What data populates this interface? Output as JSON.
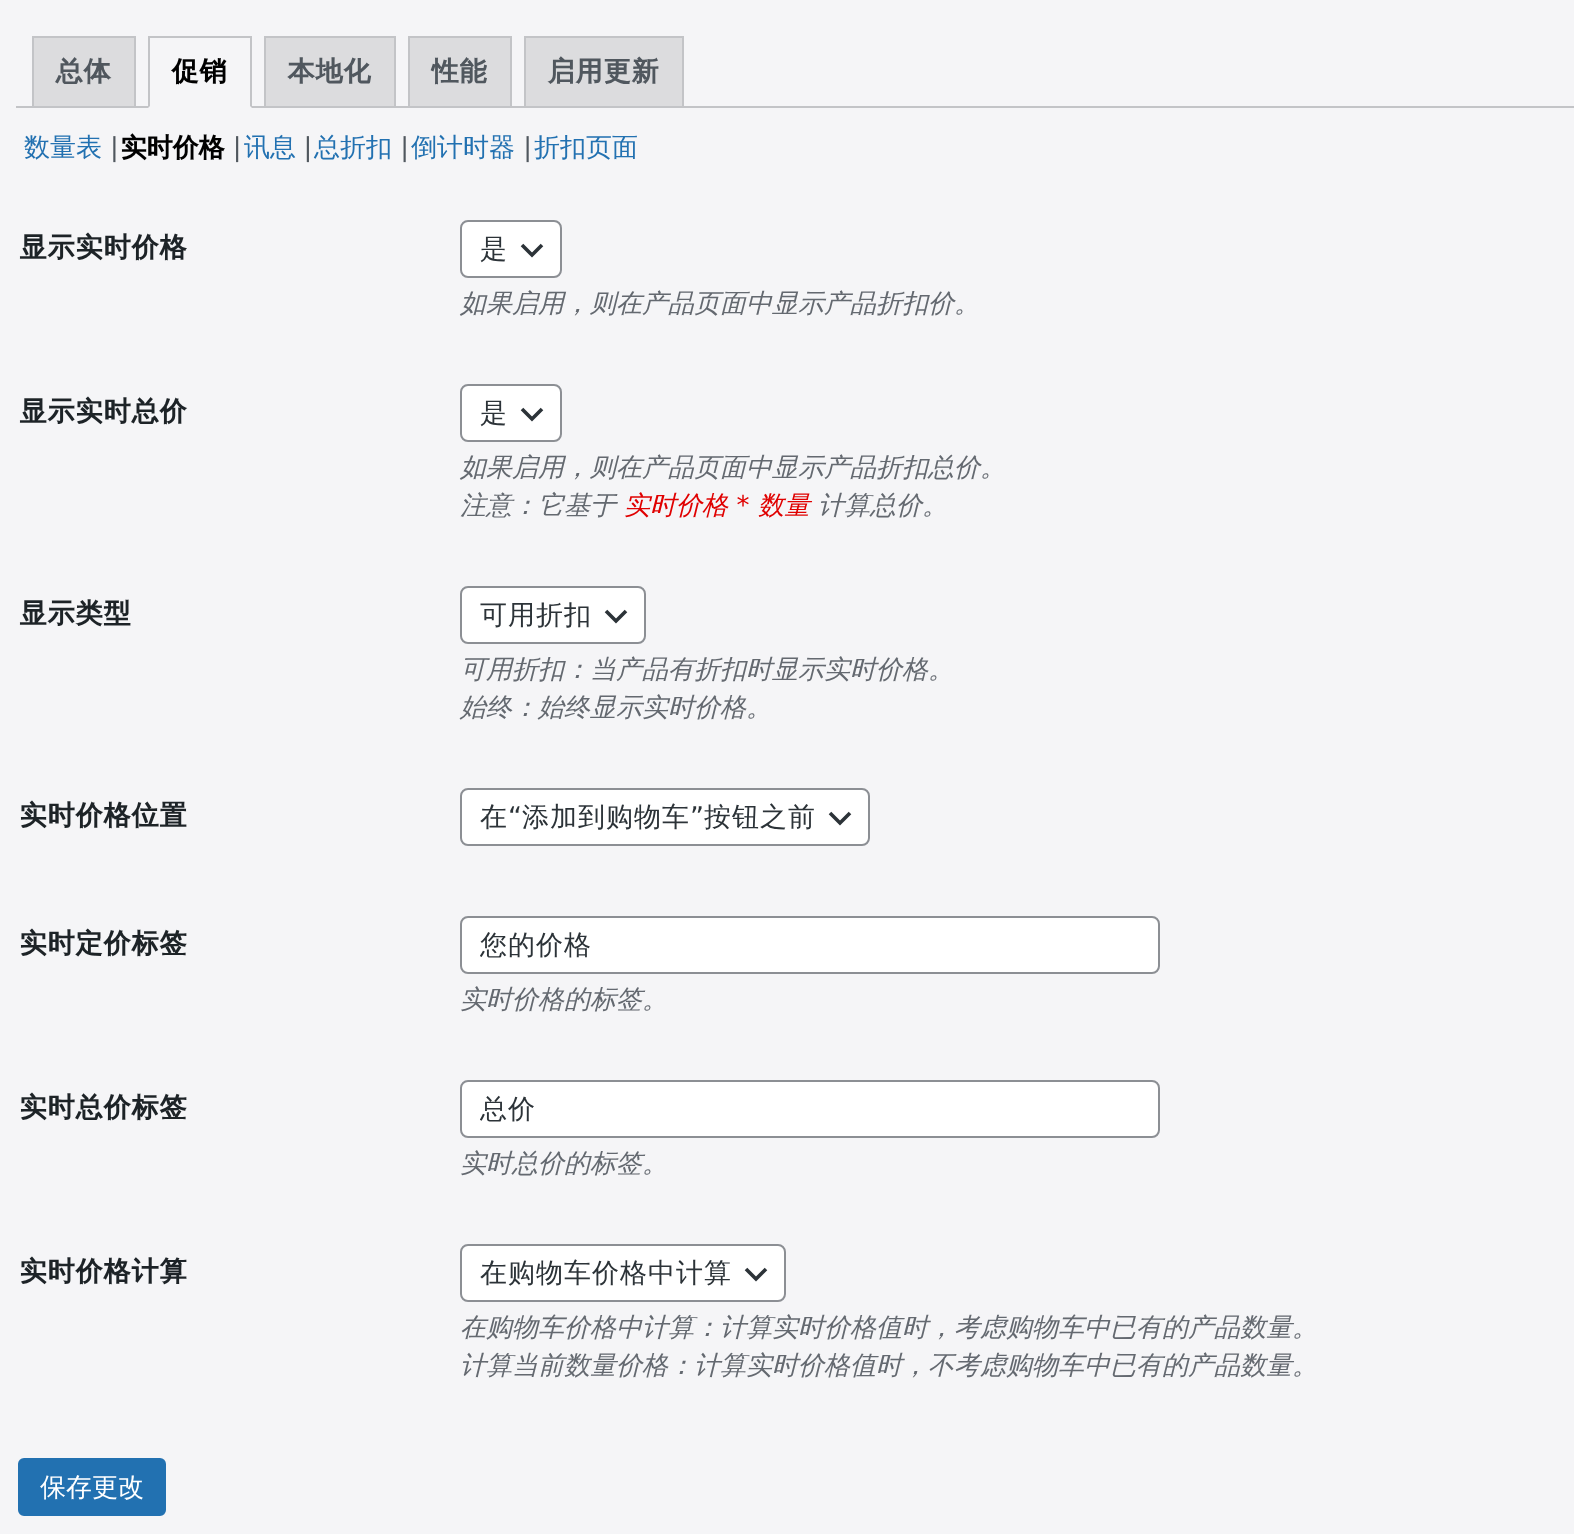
{
  "tabs": [
    {
      "label": "总体",
      "selected": false
    },
    {
      "label": "促销",
      "selected": true
    },
    {
      "label": "本地化",
      "selected": false
    },
    {
      "label": "性能",
      "selected": false
    },
    {
      "label": "启用更新",
      "selected": false
    }
  ],
  "subnav": [
    {
      "label": "数量表",
      "selected": false
    },
    {
      "separator": "|",
      "label": "实时价格",
      "selected": true
    },
    {
      "separator": "|",
      "label": "讯息",
      "selected": false
    },
    {
      "separator": "|",
      "label": "总折扣",
      "selected": false
    },
    {
      "separator": "|",
      "label": "倒计时器",
      "selected": false
    },
    {
      "separator": "|",
      "label": "折扣页面",
      "selected": false
    }
  ],
  "settings": [
    {
      "label": "显示实时价格",
      "control": {
        "kind": "select",
        "value": "是"
      },
      "description": [
        [
          {
            "text": "如果启用，则在产品页面中显示产品折扣价。",
            "highlight": false
          }
        ]
      ]
    },
    {
      "label": "显示实时总价",
      "control": {
        "kind": "select",
        "value": "是"
      },
      "description": [
        [
          {
            "text": "如果启用，则在产品页面中显示产品折扣总价。",
            "highlight": false
          }
        ],
        [
          {
            "text": "注意：它基于 ",
            "highlight": false
          },
          {
            "text": "实时价格 * 数量",
            "highlight": true
          },
          {
            "text": " 计算总价。",
            "highlight": false
          }
        ]
      ]
    },
    {
      "label": "显示类型",
      "control": {
        "kind": "select",
        "value": "可用折扣"
      },
      "description": [
        [
          {
            "text": "可用折扣：当产品有折扣时显示实时价格。",
            "highlight": false
          }
        ],
        [
          {
            "text": "始终：始终显示实时价格。",
            "highlight": false
          }
        ]
      ]
    },
    {
      "label": "实时价格位置",
      "control": {
        "kind": "select",
        "value": "在“添加到购物车”按钮之前"
      }
    },
    {
      "label": "实时定价标签",
      "control": {
        "kind": "text",
        "value": "您的价格"
      },
      "description": [
        [
          {
            "text": "实时价格的标签。",
            "highlight": false
          }
        ]
      ]
    },
    {
      "label": "实时总价标签",
      "control": {
        "kind": "text",
        "value": "总价"
      },
      "description": [
        [
          {
            "text": "实时总价的标签。",
            "highlight": false
          }
        ]
      ]
    },
    {
      "label": "实时价格计算",
      "control": {
        "kind": "select",
        "value": "在购物车价格中计算"
      },
      "description": [
        [
          {
            "text": "在购物车价格中计算：计算实时价格值时，考虑购物车中已有的产品数量。",
            "highlight": false
          }
        ],
        [
          {
            "text": "计算当前数量价格：计算实时价格值时，不考虑购物车中已有的产品数量。",
            "highlight": false
          }
        ]
      ]
    }
  ],
  "save_button": "保存更改"
}
